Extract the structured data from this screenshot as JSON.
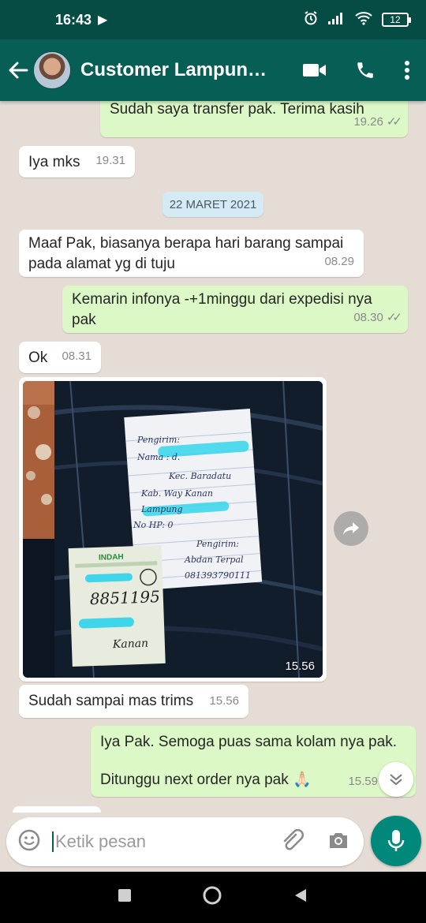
{
  "status_bar": {
    "time": "16:43",
    "battery": "12"
  },
  "header": {
    "title": "Customer Lampung...",
    "icons": [
      "back-arrow-icon",
      "video-call-icon",
      "voice-call-icon",
      "more-vert-icon"
    ]
  },
  "messages": [
    {
      "dir": "out",
      "text": "Sudah saya transfer pak. Terima kasih",
      "time": "19.26",
      "ticks": "✓✓"
    },
    {
      "dir": "in",
      "text": "Iya mks",
      "time": "19.31"
    },
    {
      "dir": "date",
      "text": "22 MARET 2021"
    },
    {
      "dir": "in",
      "text": "Maaf Pak, biasanya berapa hari barang sampai pada alamat yg di tuju",
      "time": "08.29"
    },
    {
      "dir": "out",
      "text": "Kemarin infonya -+1minggu dari expedisi nya pak",
      "time": "08.30",
      "ticks": "✓✓"
    },
    {
      "dir": "in",
      "text": "Ok",
      "time": "08.31"
    },
    {
      "dir": "in-image",
      "time": "15.56"
    },
    {
      "dir": "in",
      "text": "Sudah sampai mas trims",
      "time": "15.56"
    },
    {
      "dir": "out",
      "text_lines": [
        "Iya Pak. Semoga puas sama kolam nya pak.",
        "Ditunggu next order nya pak 🙏🏻"
      ],
      "time": "15.59"
    }
  ],
  "photo": {
    "note_lines": [
      "Pengirim:",
      "Nama : d.",
      "Kec. Baradatu",
      "Kab. Way Kanan",
      "Lampung",
      "No HP: 0",
      "Pengirim:",
      "Abdan Terpal",
      "081393790111"
    ],
    "label_code": "8851195",
    "label_brand": "INDAH",
    "label_extra": "Kanan"
  },
  "input": {
    "placeholder": "Ketik pesan"
  },
  "colors": {
    "status": "#054d44",
    "header": "#075e54",
    "outgoing": "#dcf8c6",
    "incoming": "#ffffff",
    "mic": "#00897b"
  }
}
